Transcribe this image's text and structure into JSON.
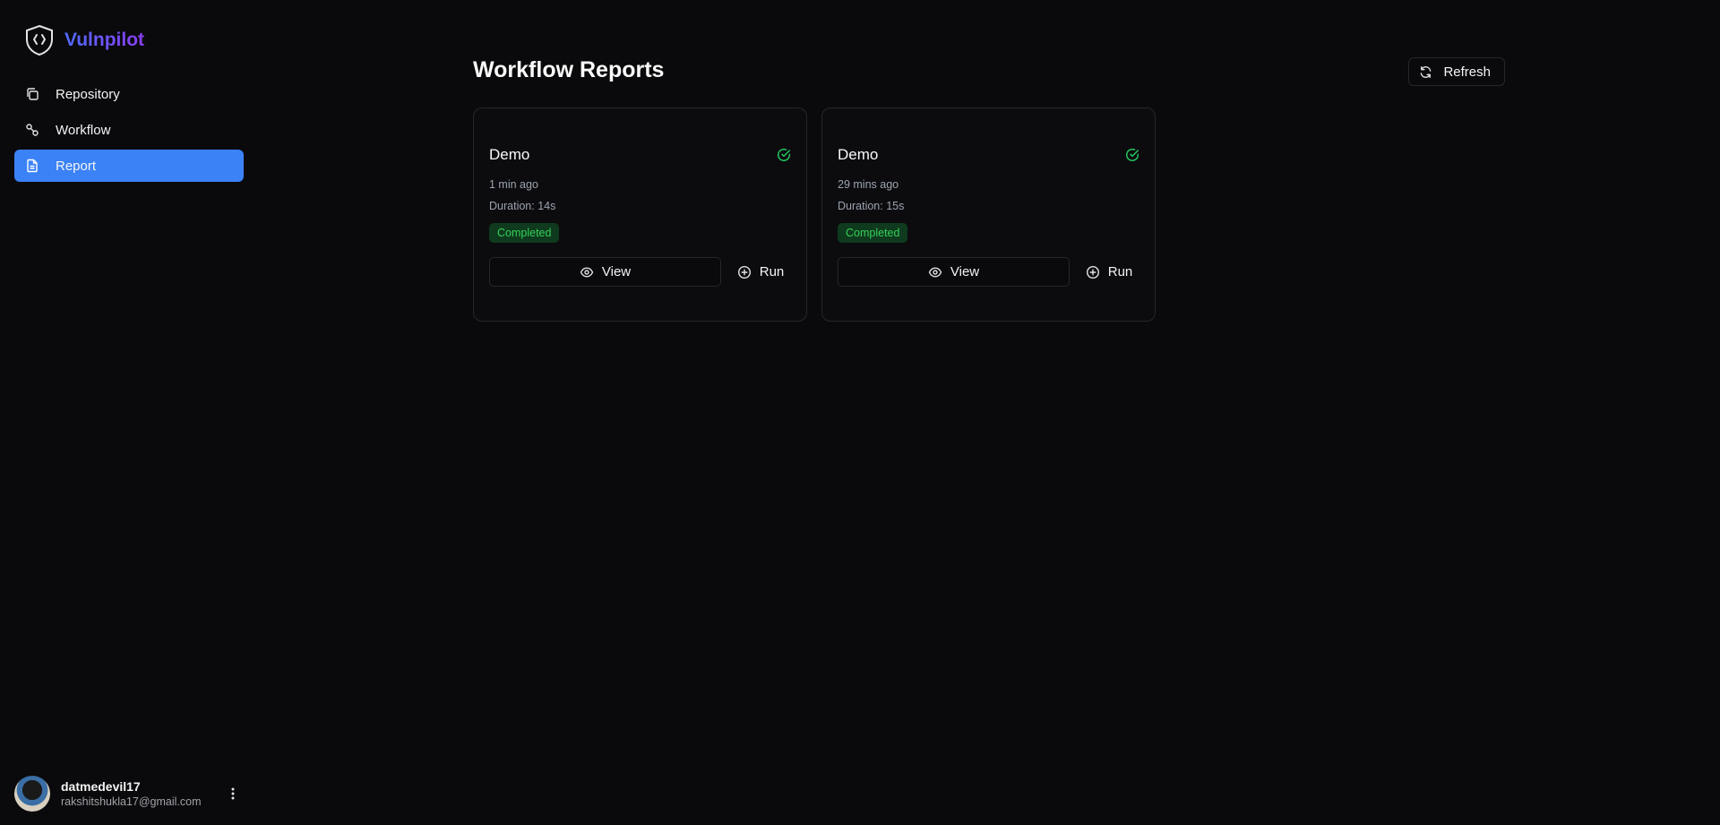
{
  "brand": {
    "name": "Vulnpilot",
    "logo_icon": "shield-code-icon"
  },
  "nav": {
    "items": [
      {
        "label": "Repository",
        "icon": "copy-icon",
        "active": false
      },
      {
        "label": "Workflow",
        "icon": "workflow-icon",
        "active": false
      },
      {
        "label": "Report",
        "icon": "file-text-icon",
        "active": true
      }
    ]
  },
  "user": {
    "name": "datmedevil17",
    "email": "rakshitshukla17@gmail.com",
    "menu_icon": "more-vertical-icon"
  },
  "header": {
    "title": "Workflow Reports",
    "refresh_label": "Refresh",
    "refresh_icon": "refresh-icon"
  },
  "reports": [
    {
      "title": "Demo",
      "time": "1 min ago",
      "duration": "Duration: 14s",
      "status": "Completed",
      "view_label": "View",
      "run_label": "Run"
    },
    {
      "title": "Demo",
      "time": "29 mins ago",
      "duration": "Duration: 15s",
      "status": "Completed",
      "view_label": "View",
      "run_label": "Run"
    }
  ],
  "colors": {
    "background": "#0a0a0c",
    "accent": "#3b82f6",
    "success": "#22c55e",
    "badge_bg": "#0f3a1e",
    "brand_start": "#4f6bff",
    "brand_end": "#8b3df5"
  }
}
